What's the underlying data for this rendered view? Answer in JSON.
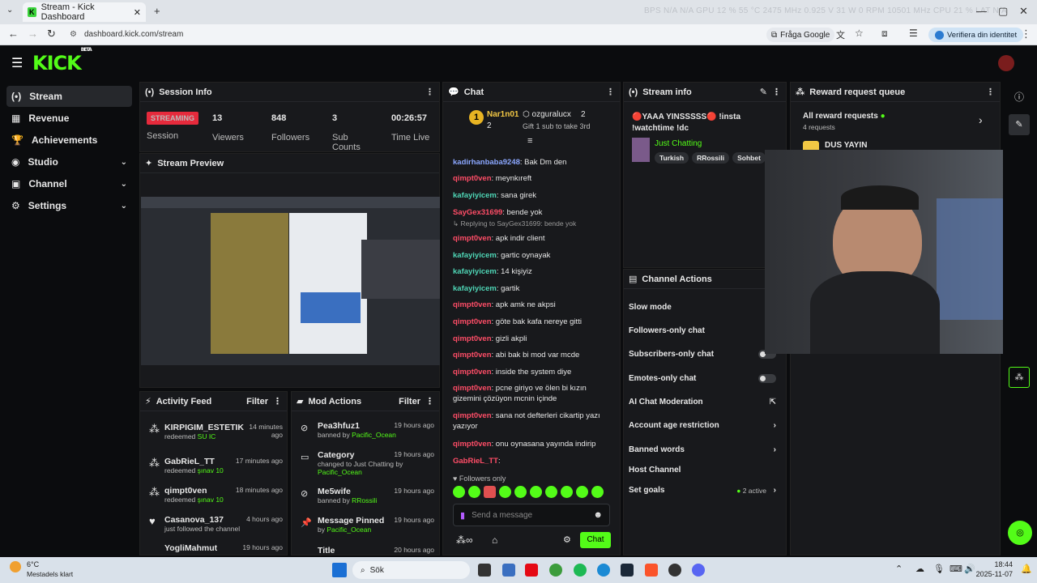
{
  "browser": {
    "tab_title": "Stream - Kick Dashboard",
    "url": "dashboard.kick.com/stream",
    "ask_google": "Fråga Google",
    "profile": "Verifiera din identitet",
    "overlay": "BPS  N/A  N/A     GPU  12 %  55 °C  2475 MHz  0.925 V  31 W  0 RPM  10501 MHz     CPU  21 %     LAT  N/A"
  },
  "logo": {
    "text": "KICK",
    "sup": "BETA"
  },
  "sidebar": {
    "items": [
      {
        "label": "Stream",
        "icon": "(•)"
      },
      {
        "label": "Revenue",
        "icon": "▦"
      },
      {
        "label": "Achievements",
        "icon": "🏆"
      },
      {
        "label": "Studio",
        "icon": "◉"
      },
      {
        "label": "Channel",
        "icon": "▣"
      },
      {
        "label": "Settings",
        "icon": "⚙"
      }
    ]
  },
  "session": {
    "title": "Session Info",
    "status": "STREAMING",
    "status_label": "Session",
    "viewers": "13",
    "viewers_label": "Viewers",
    "followers": "848",
    "followers_label": "Followers",
    "subs": "3",
    "subs_label": "Sub Counts",
    "time": "00:26:57",
    "time_label": "Time Live"
  },
  "preview": {
    "title": "Stream Preview"
  },
  "activity": {
    "title": "Activity Feed",
    "filter": "Filter",
    "rows": [
      {
        "name": "KIRPIGIM_ESTETIK",
        "action": "redeemed",
        "item": "SU IC",
        "time": "14 minutes ago"
      },
      {
        "name": "GabRieL_TT",
        "action": "redeemed",
        "item": "şınav 10",
        "time": "17 minutes ago"
      },
      {
        "name": "qimpt0ven",
        "action": "redeemed",
        "item": "şınav 10",
        "time": "18 minutes ago"
      },
      {
        "name": "Casanova_137",
        "action": "just followed the channel",
        "item": "",
        "time": "4 hours ago"
      },
      {
        "name": "YogliMahmut",
        "action": "",
        "item": "",
        "time": "19 hours ago"
      }
    ]
  },
  "mod": {
    "title": "Mod Actions",
    "filter": "Filter",
    "rows": [
      {
        "name": "Pea3hfuz1",
        "desc": "banned by",
        "by": "Pacific_Ocean",
        "time": "19 hours ago"
      },
      {
        "name": "Category",
        "desc": "changed to Just Chatting by",
        "by": "Pacific_Ocean",
        "time": "19 hours ago"
      },
      {
        "name": "Me5wife",
        "desc": "banned by",
        "by": "RRossili",
        "time": "19 hours ago"
      },
      {
        "name": "Message Pinned",
        "desc": "by",
        "by": "Pacific_Ocean",
        "time": "19 hours ago"
      },
      {
        "name": "Title",
        "desc": "",
        "by": "",
        "time": "20 hours ago"
      }
    ]
  },
  "chat": {
    "title": "Chat",
    "top1": "Nar1n01",
    "top1_count": "2",
    "top2": "ozguralucx",
    "top2_count": "2",
    "gift_text": "Gift 1 sub to take 3rd",
    "messages": [
      {
        "user": "kadirhanbaba9248",
        "text": ": Bak Dm den",
        "cls": "u-blue"
      },
      {
        "user": "qimpt0ven",
        "text": ": meynkıreft",
        "cls": "u-red"
      },
      {
        "user": "kafayiyicem",
        "text": ": sana girek",
        "cls": "u-teal"
      },
      {
        "user": "SayGex31699",
        "text": ": bende yok",
        "cls": "u-red"
      },
      {
        "user": "",
        "text": "↳ Replying to SayGex31699: bende yok",
        "cls": ""
      },
      {
        "user": "qimpt0ven",
        "text": ": apk indir client",
        "cls": "u-red"
      },
      {
        "user": "kafayiyicem",
        "text": ": gartic oynayak",
        "cls": "u-teal"
      },
      {
        "user": "kafayiyicem",
        "text": ": 14 kişiyiz",
        "cls": "u-teal"
      },
      {
        "user": "kafayiyicem",
        "text": ": gartik",
        "cls": "u-teal"
      },
      {
        "user": "qimpt0ven",
        "text": ": apk amk ne akpsi",
        "cls": "u-red"
      },
      {
        "user": "qimpt0ven",
        "text": ": göte bak kafa nereye gitti",
        "cls": "u-red"
      },
      {
        "user": "qimpt0ven",
        "text": ": gizli akpli",
        "cls": "u-red"
      },
      {
        "user": "qimpt0ven",
        "text": ": abi bak bi mod var mcde",
        "cls": "u-red"
      },
      {
        "user": "qimpt0ven",
        "text": ": inside the system diye",
        "cls": "u-red"
      },
      {
        "user": "qimpt0ven",
        "text": ": pcne giriyo ve ölen bi kızın gizemini çözüyon mcnin içinde",
        "cls": "u-red"
      },
      {
        "user": "qimpt0ven",
        "text": ": sana not defterleri cikartip yazı yazıyor",
        "cls": "u-red"
      },
      {
        "user": "qimpt0ven",
        "text": ": onu oynasana yayında indirip",
        "cls": "u-red"
      },
      {
        "user": "GabRieL_TT",
        "text": ":",
        "cls": "u-red"
      }
    ],
    "followers_only": "Followers only",
    "placeholder": "Send a message",
    "send": "Chat"
  },
  "streaminfo": {
    "title": "Stream info",
    "stream_title": "🔴YAAA YINSSSSS🔴 !insta !watchtime !dc",
    "category": "Just Chatting",
    "tags": [
      "Turkish",
      "RRossili",
      "Sohbet"
    ]
  },
  "reward": {
    "title": "Reward request queue",
    "all": "All reward requests",
    "count": "4 requests",
    "item": "DUS YAYIN"
  },
  "actions": {
    "title": "Channel Actions",
    "items": [
      "Slow mode",
      "Followers-only chat",
      "Subscribers-only chat",
      "Emotes-only chat",
      "AI Chat Moderation",
      "Account age restriction",
      "Banned words",
      "Host Channel",
      "Set goals"
    ],
    "goals_active": "2 active"
  },
  "taskbar": {
    "temp": "6°C",
    "weather": "Mestadels klart",
    "search": "Sök",
    "time": "18:44",
    "date": "2025-11-07"
  },
  "colors": {
    "accent": "#53fc18",
    "live": "#e62a3c"
  }
}
